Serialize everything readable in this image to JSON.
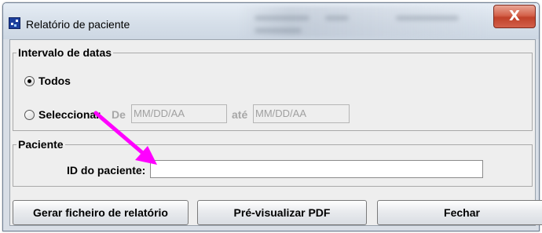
{
  "window": {
    "title": "Relatório de paciente",
    "close_glyph": "X"
  },
  "date_range": {
    "legend": "Intervalo de datas",
    "all_label": "Todos",
    "all_selected": true,
    "select_label": "Seleccionar",
    "select_selected": false,
    "from_label": "De",
    "from_placeholder": "MM/DD/AA",
    "to_label": "até",
    "to_placeholder": "MM/DD/AA"
  },
  "patient": {
    "legend": "Paciente",
    "id_label": "ID do paciente:",
    "id_value": ""
  },
  "buttons": {
    "generate_label": "Gerar ficheiro de relatório",
    "preview_label": "Pré-visualizar PDF",
    "close_label": "Fechar"
  },
  "annotation": {
    "arrow_color": "#ff00ff",
    "arrow_icon": "arrow-pointer-icon"
  },
  "colors": {
    "window_frame": "#d8dee6",
    "content_bg": "#eeeeee",
    "close_button": "#c8452f"
  }
}
